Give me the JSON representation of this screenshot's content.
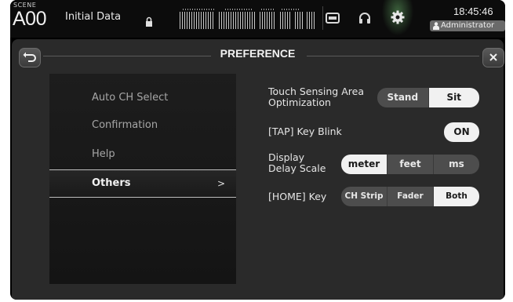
{
  "topbar": {
    "scene_label": "SCENE",
    "scene_number": "A00",
    "scene_title": "Initial Data",
    "time": "18:45:46",
    "user": "Administrator",
    "icons": [
      "lock-icon",
      "meter-bridge",
      "card-icon",
      "headphones-icon",
      "gear-icon",
      "person-icon"
    ]
  },
  "panel": {
    "title": "PREFERENCE",
    "back_icon": "back-arrow-icon",
    "close_icon": "close-icon"
  },
  "menu": {
    "items": [
      {
        "label": "Auto CH Select",
        "active": false
      },
      {
        "label": "Confirmation",
        "active": false
      },
      {
        "label": "Help",
        "active": false
      },
      {
        "label": "Others",
        "active": true
      }
    ],
    "active_arrow": ">"
  },
  "settings": {
    "touch_sensing": {
      "label_line1": "Touch Sensing Area",
      "label_line2": "Optimization",
      "options": [
        "Stand",
        "Sit"
      ],
      "selected": "Sit"
    },
    "tap_blink": {
      "label": "[TAP] Key Blink",
      "value": "ON"
    },
    "delay_scale": {
      "label_line1": "Display",
      "label_line2": "Delay Scale",
      "options": [
        "meter",
        "feet",
        "ms"
      ],
      "selected": "meter"
    },
    "home_key": {
      "label": "[HOME] Key",
      "options": [
        "CH Strip",
        "Fader",
        "Both"
      ],
      "selected": "Both"
    }
  },
  "colors": {
    "panel_bg": "#2a2a2a",
    "selected_button": "#f1f1f1",
    "unselected_button": "#4d4d4d",
    "gear_glow": "#96ff96"
  }
}
